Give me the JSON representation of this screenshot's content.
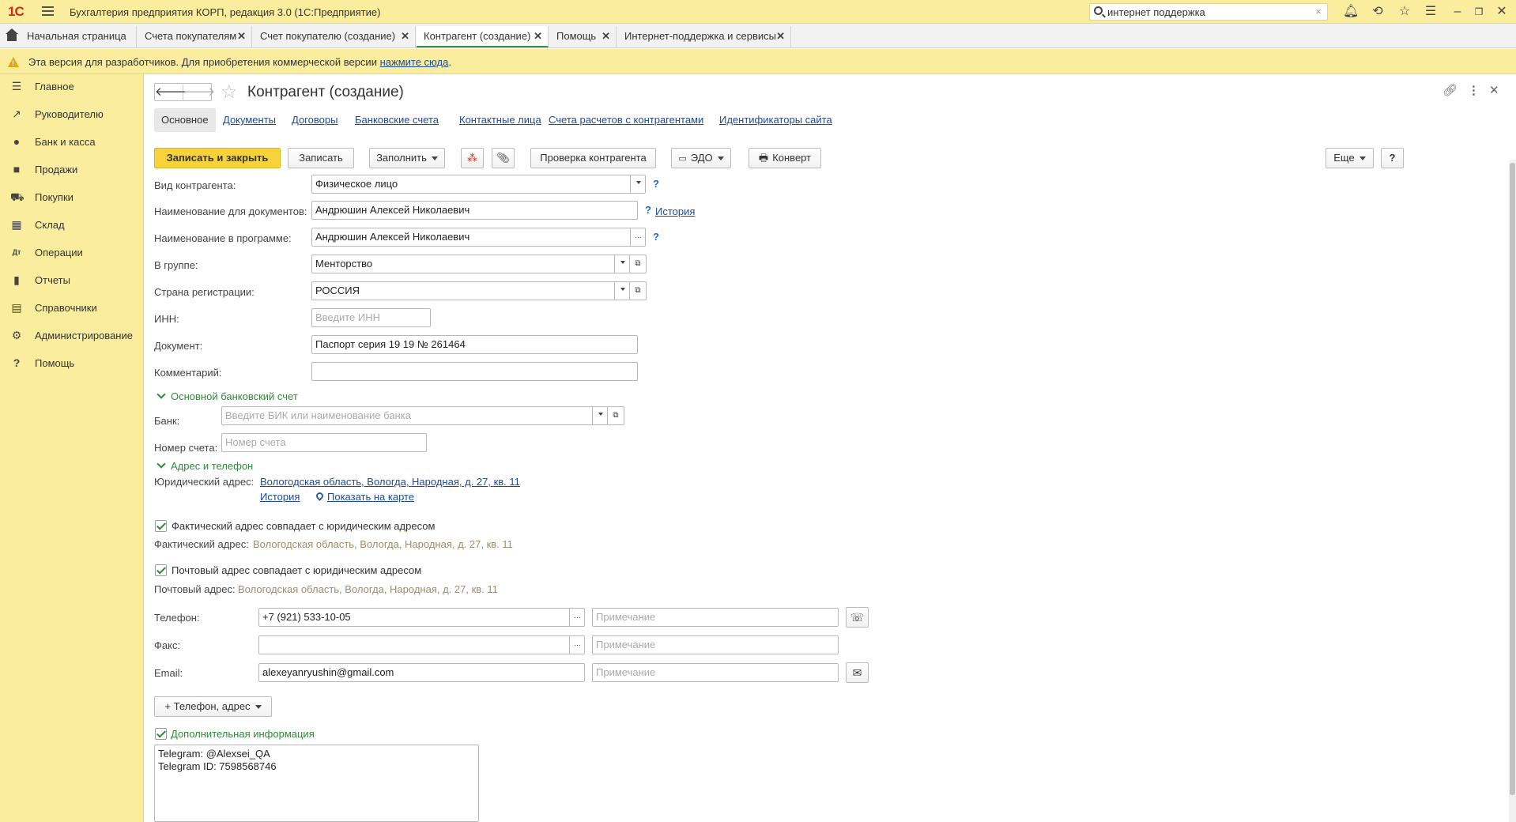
{
  "app": {
    "title": "Бухгалтерия предприятия КОРП, редакция 3.0  (1С:Предприятие)",
    "logo": "1С",
    "search_value": "интернет поддержка"
  },
  "tabs": [
    {
      "label": "Начальная страница"
    },
    {
      "label": "Счета покупателям"
    },
    {
      "label": "Счет покупателю (создание)"
    },
    {
      "label": "Контрагент (создание)"
    },
    {
      "label": "Помощь"
    },
    {
      "label": "Интернет-поддержка и сервисы"
    }
  ],
  "warning": {
    "text": "Эта версия для разработчиков. Для приобретения коммерческой версии",
    "link": "нажмите сюда",
    "tail": "."
  },
  "sidebar": {
    "items": [
      {
        "label": "Главное",
        "icon": "menu-lines-icon"
      },
      {
        "label": "Руководителю",
        "icon": "trend-icon"
      },
      {
        "label": "Банк и касса",
        "icon": "coin-icon"
      },
      {
        "label": "Продажи",
        "icon": "bag-icon"
      },
      {
        "label": "Покупки",
        "icon": "cart-icon"
      },
      {
        "label": "Склад",
        "icon": "boxes-icon"
      },
      {
        "label": "Операции",
        "icon": "dt-kt-icon"
      },
      {
        "label": "Отчеты",
        "icon": "bar-chart-icon"
      },
      {
        "label": "Справочники",
        "icon": "books-icon"
      },
      {
        "label": "Администрирование",
        "icon": "gear-icon"
      },
      {
        "label": "Помощь",
        "icon": "question-icon"
      }
    ]
  },
  "form": {
    "title": "Контрагент (создание)",
    "subtabs": [
      {
        "label": "Основное"
      },
      {
        "label": "Документы"
      },
      {
        "label": "Договоры"
      },
      {
        "label": "Банковские счета"
      },
      {
        "label": "Контактные лица"
      },
      {
        "label": "Счета расчетов с контрагентами"
      },
      {
        "label": "Идентификаторы сайта"
      }
    ],
    "toolbar": {
      "save_close": "Записать и закрыть",
      "save": "Записать",
      "fill": "Заполнить",
      "check": "Проверка контрагента",
      "edo": "ЭДО",
      "envelope": "Конверт",
      "more": "Еще",
      "help": "?"
    },
    "fields": {
      "kind_label": "Вид контрагента:",
      "kind_value": "Физическое лицо",
      "docname_label": "Наименование для документов:",
      "docname_value": "Андрюшин Алексей Николаевич",
      "history_link": "История",
      "progname_label": "Наименование в программе:",
      "progname_value": "Андрюшин Алексей Николаевич",
      "group_label": "В группе:",
      "group_value": "Менторство",
      "country_label": "Страна регистрации:",
      "country_value": "РОССИЯ",
      "inn_label": "ИНН:",
      "inn_placeholder": "Введите ИНН",
      "document_label": "Документ:",
      "document_value": "Паспорт серия 19 19 № 261464",
      "comment_label": "Комментарий:",
      "comment_value": ""
    },
    "bank": {
      "header": "Основной банковский счет",
      "bank_label": "Банк:",
      "bank_placeholder": "Введите БИК или наименование банка",
      "account_label": "Номер счета:",
      "account_placeholder": "Номер счета"
    },
    "address": {
      "header": "Адрес и телефон",
      "legal_label": "Юридический адрес:",
      "legal_value": "Вологодская область, Вологда, Народная, д. 27, кв. 11",
      "history_link": "История",
      "map_link": "Показать на карте",
      "fact_same_label": "Фактический адрес совпадает с юридическим адресом",
      "fact_label": "Фактический адрес:",
      "fact_value": "Вологодская область, Вологда, Народная, д. 27, кв. 11",
      "post_same_label": "Почтовый адрес совпадает с юридическим адресом",
      "post_label": "Почтовый адрес:",
      "post_value": "Вологодская область, Вологда, Народная, д. 27, кв. 11"
    },
    "contacts": {
      "phone_label": "Телефон:",
      "phone_value": "+7 (921) 533-10-05",
      "fax_label": "Факс:",
      "fax_value": "",
      "email_label": "Email:",
      "email_value": "alexeyanryushin@gmail.com",
      "note_placeholder": "Примечание",
      "add_button": "+ Телефон, адрес"
    },
    "extra": {
      "header": "Дополнительная информация",
      "text": "Telegram: @Alexsei_QA\nTelegram ID: 7598568746"
    }
  }
}
